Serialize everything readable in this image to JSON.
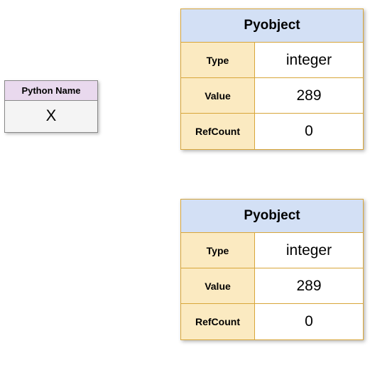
{
  "name_box": {
    "header": "Python Name",
    "value": "X"
  },
  "pyobjects": [
    {
      "title": "Pyobject",
      "rows": [
        {
          "label": "Type",
          "value": "integer"
        },
        {
          "label": "Value",
          "value": "289"
        },
        {
          "label": "RefCount",
          "value": "0"
        }
      ]
    },
    {
      "title": "Pyobject",
      "rows": [
        {
          "label": "Type",
          "value": "integer"
        },
        {
          "label": "Value",
          "value": "289"
        },
        {
          "label": "RefCount",
          "value": "0"
        }
      ]
    }
  ]
}
